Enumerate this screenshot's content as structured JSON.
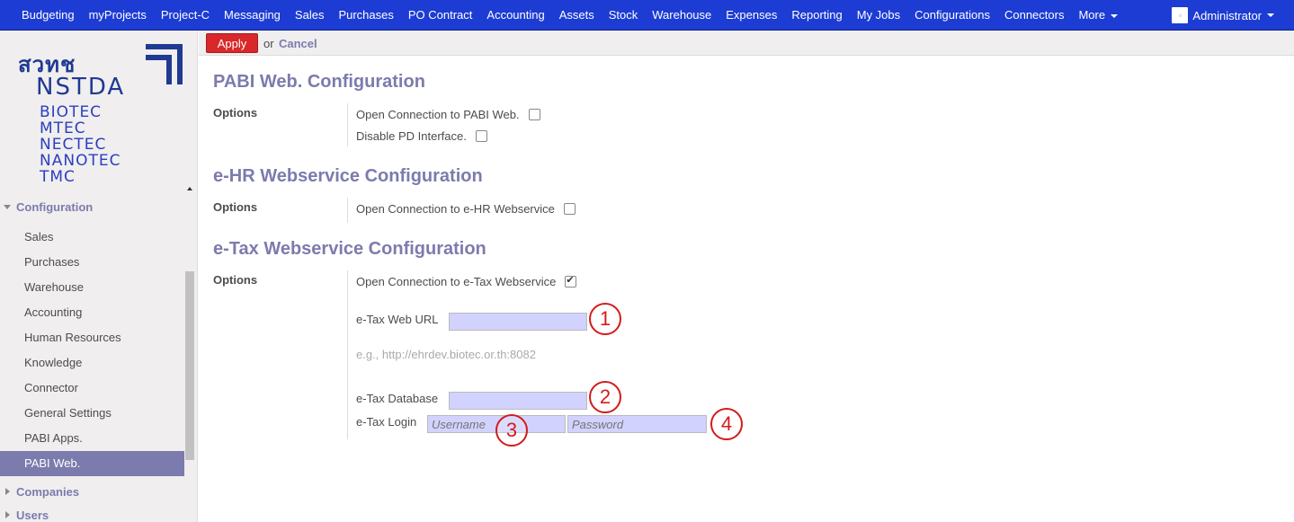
{
  "topnav": {
    "items": [
      "Budgeting",
      "myProjects",
      "Project-C",
      "Messaging",
      "Sales",
      "Purchases",
      "PO Contract",
      "Accounting",
      "Assets",
      "Stock",
      "Warehouse",
      "Expenses",
      "Reporting",
      "My Jobs",
      "Configurations",
      "Connectors"
    ],
    "more_label": "More",
    "user_label": "Administrator"
  },
  "logo": {
    "thai": "สวทช",
    "name": "NSTDA",
    "subs": [
      "BIOTEC",
      "MTEC",
      "NECTEC",
      "NANOTEC",
      "TMC"
    ]
  },
  "sidebar": {
    "section_label": "Configuration",
    "items": [
      "Sales",
      "Purchases",
      "Warehouse",
      "Accounting",
      "Human Resources",
      "Knowledge",
      "Connector",
      "General Settings",
      "PABI Apps.",
      "PABI Web."
    ],
    "active_item": "PABI Web.",
    "collapsed_sections": [
      "Companies",
      "Users"
    ]
  },
  "toolbar": {
    "apply_label": "Apply",
    "or_text": "or",
    "cancel_label": "Cancel"
  },
  "sections": {
    "pabi": {
      "title": "PABI Web. Configuration",
      "options_label": "Options",
      "opt1": "Open Connection to PABI Web.",
      "opt2": "Disable PD Interface."
    },
    "ehr": {
      "title": "e-HR Webservice Configuration",
      "options_label": "Options",
      "opt1": "Open Connection to e-HR Webservice"
    },
    "etax": {
      "title": "e-Tax Webservice Configuration",
      "options_label": "Options",
      "opt1": "Open Connection to e-Tax Webservice",
      "opt1_checked": true,
      "url_label": "e-Tax Web URL",
      "url_value": "",
      "url_hint": "e.g., http://ehrdev.biotec.or.th:8082",
      "db_label": "e-Tax Database",
      "db_value": "",
      "login_label": "e-Tax Login",
      "username_placeholder": "Username",
      "password_placeholder": "Password"
    }
  },
  "annotations": [
    "1",
    "2",
    "3",
    "4"
  ],
  "colors": {
    "topbar": "#1d3cd3",
    "accent": "#7c7bad",
    "apply": "#d9272a",
    "input_bg": "#d2d2ff",
    "annotation": "#d51a1a"
  }
}
